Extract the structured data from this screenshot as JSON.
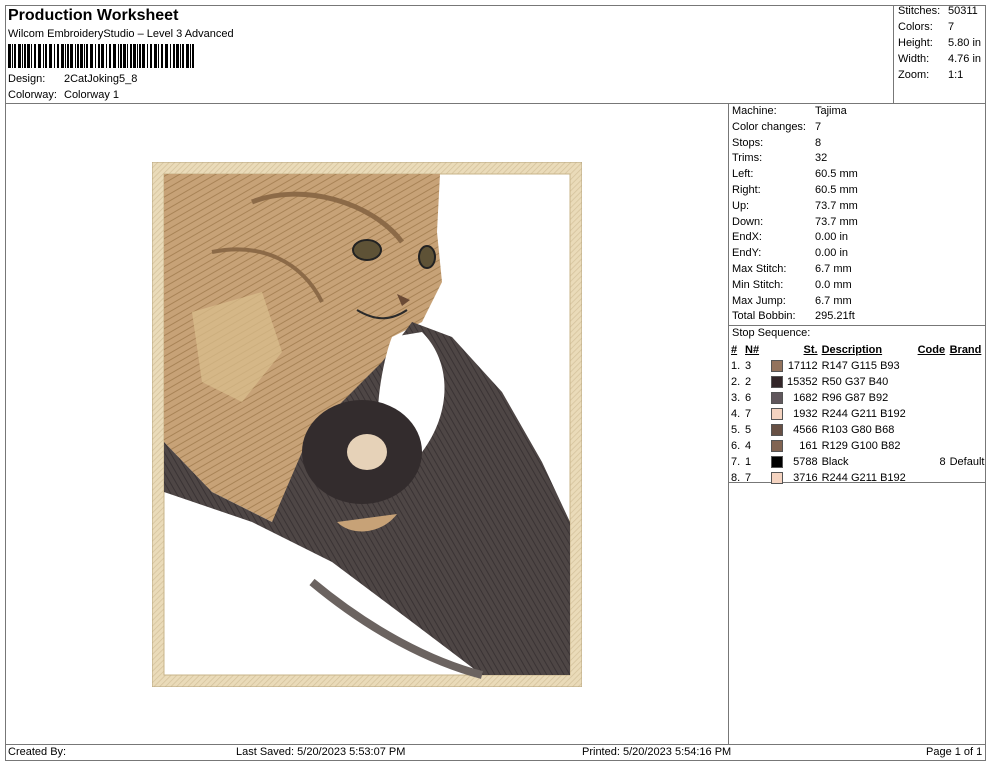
{
  "header": {
    "title": "Production Worksheet",
    "software": "Wilcom EmbroideryStudio – Level 3 Advanced",
    "design_label": "Design:",
    "design_value": "2CatJoking5_8",
    "colorway_label": "Colorway:",
    "colorway_value": "Colorway 1"
  },
  "summary": [
    {
      "label": "Stitches:",
      "value": "50311"
    },
    {
      "label": "Colors:",
      "value": "7"
    },
    {
      "label": "Height:",
      "value": "5.80 in"
    },
    {
      "label": "Width:",
      "value": "4.76 in"
    },
    {
      "label": "Zoom:",
      "value": "1:1"
    }
  ],
  "machine": [
    {
      "label": "Machine:",
      "value": "Tajima"
    },
    {
      "label": "Color changes:",
      "value": "7"
    },
    {
      "label": "Stops:",
      "value": "8"
    },
    {
      "label": "Trims:",
      "value": "32"
    },
    {
      "label": "Left:",
      "value": "60.5 mm"
    },
    {
      "label": "Right:",
      "value": "60.5 mm"
    },
    {
      "label": "Up:",
      "value": "73.7 mm"
    },
    {
      "label": "Down:",
      "value": "73.7 mm"
    },
    {
      "label": "EndX:",
      "value": "0.00 in"
    },
    {
      "label": "EndY:",
      "value": "0.00 in"
    },
    {
      "label": "Max Stitch:",
      "value": "6.7 mm"
    },
    {
      "label": "Min Stitch:",
      "value": "0.0 mm"
    },
    {
      "label": "Max Jump:",
      "value": "6.7 mm"
    },
    {
      "label": "Total Bobbin:",
      "value": "295.21ft"
    }
  ],
  "stop_sequence": {
    "title": "Stop Sequence:",
    "headers": {
      "num": "#",
      "n": "N#",
      "st": "St.",
      "desc": "Description",
      "code": "Code",
      "brand": "Brand"
    },
    "rows": [
      {
        "num": "1.",
        "n": "3",
        "color": "#93735d",
        "st": "17112",
        "desc": "R147 G115 B93",
        "code": "",
        "brand": ""
      },
      {
        "num": "2.",
        "n": "2",
        "color": "#322528",
        "st": "15352",
        "desc": "R50 G37 B40",
        "code": "",
        "brand": ""
      },
      {
        "num": "3.",
        "n": "6",
        "color": "#60575c",
        "st": "1682",
        "desc": "R96 G87 B92",
        "code": "",
        "brand": ""
      },
      {
        "num": "4.",
        "n": "7",
        "color": "#f4d3c0",
        "st": "1932",
        "desc": "R244 G211 B192",
        "code": "",
        "brand": ""
      },
      {
        "num": "5.",
        "n": "5",
        "color": "#675044",
        "st": "4566",
        "desc": "R103 G80 B68",
        "code": "",
        "brand": ""
      },
      {
        "num": "6.",
        "n": "4",
        "color": "#816452",
        "st": "161",
        "desc": "R129 G100 B82",
        "code": "",
        "brand": ""
      },
      {
        "num": "7.",
        "n": "1",
        "color": "#000000",
        "st": "5788",
        "desc": "Black",
        "code": "8",
        "brand": "Default"
      },
      {
        "num": "8.",
        "n": "7",
        "color": "#f4d3c0",
        "st": "3716",
        "desc": "R244 G211 B192",
        "code": "",
        "brand": ""
      }
    ]
  },
  "footer": {
    "created": "Created By:",
    "saved": "Last Saved: 5/20/2023 5:53:07 PM",
    "printed": "Printed: 5/20/2023 5:54:16 PM",
    "page": "Page 1 of 1"
  }
}
